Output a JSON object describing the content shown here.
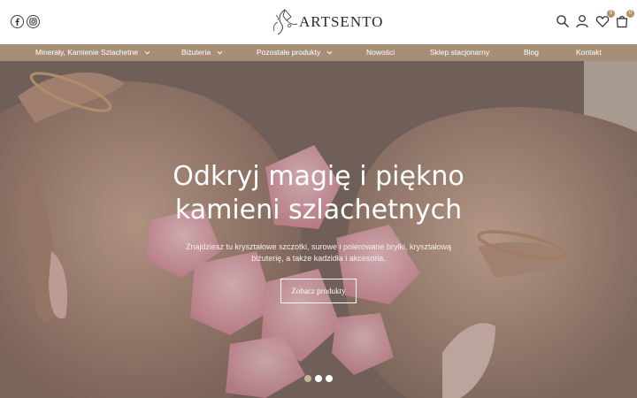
{
  "header": {
    "brand": "ARTSENTO",
    "social": [
      {
        "icon": "facebook-icon"
      },
      {
        "icon": "instagram-icon"
      }
    ],
    "actions": {
      "search_icon": "search-icon",
      "account_icon": "user-icon",
      "wishlist_icon": "heart-icon",
      "wishlist_count": "0",
      "cart_icon": "bag-icon",
      "cart_count": "0"
    }
  },
  "nav": {
    "items": [
      {
        "label": "Minerały, Kamienie Szlachetne",
        "has_dropdown": true
      },
      {
        "label": "Biżuteria",
        "has_dropdown": true
      },
      {
        "label": "Pozostałe produkty",
        "has_dropdown": true
      },
      {
        "label": "Nowości",
        "has_dropdown": false
      },
      {
        "label": "Sklep stacjonarny",
        "has_dropdown": false
      },
      {
        "label": "Blog",
        "has_dropdown": false
      },
      {
        "label": "Kontakt",
        "has_dropdown": false
      }
    ]
  },
  "hero": {
    "title_line1": "Odkryj magię i piękno",
    "title_line2": "kamieni szlachetnych",
    "subtitle_line1": "Znajdziesz tu kryształowe szczotki, surowe i polerowane bryłki, kryształową",
    "subtitle_line2": "biżuterię, a także kadzidła i akcesoria.",
    "button_label": "Zobacz produkty",
    "slider": {
      "count": 3,
      "active_index": 0
    }
  },
  "colors": {
    "nav_bg": "#a68e77",
    "badge": "#b29567",
    "dot_active": "#c8b49a",
    "dot_inactive": "#ffffff"
  }
}
